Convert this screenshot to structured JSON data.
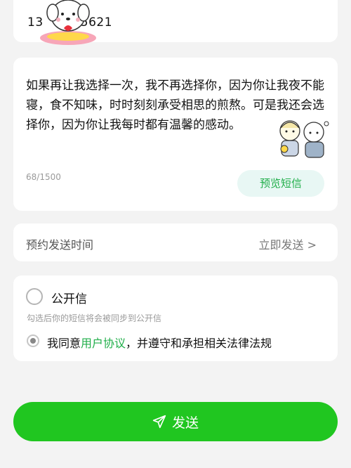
{
  "phone": {
    "text": "13         5621"
  },
  "message": {
    "text": "如果再让我选择一次，我不再选择你，因为你让我夜不能寝，食不知味，时时刻刻承受相思的煎熬。可是我还会选择你，因为你让我每时都有温馨的感动。",
    "char_count": "68/1500",
    "preview_label": "预览短信"
  },
  "schedule": {
    "label": "预约发送时间",
    "value": "立即发送 >"
  },
  "options": {
    "public_label": "公开信",
    "public_hint": "勾选后你的短信将会被同步到公开信",
    "agree_prefix": "我同意",
    "agree_link": "用户协议",
    "agree_suffix": "，并遵守和承担相关法律法规"
  },
  "send": {
    "label": "发送"
  },
  "colors": {
    "accent": "#20c620",
    "link": "#1fae49",
    "preview_bg": "#e8f7f4",
    "background": "#f3f3f3"
  },
  "icons": {
    "send": "paper-plane-icon",
    "phone_sticker": "puppy-sticker-icon",
    "message_sticker": "couple-sticker-icon"
  }
}
